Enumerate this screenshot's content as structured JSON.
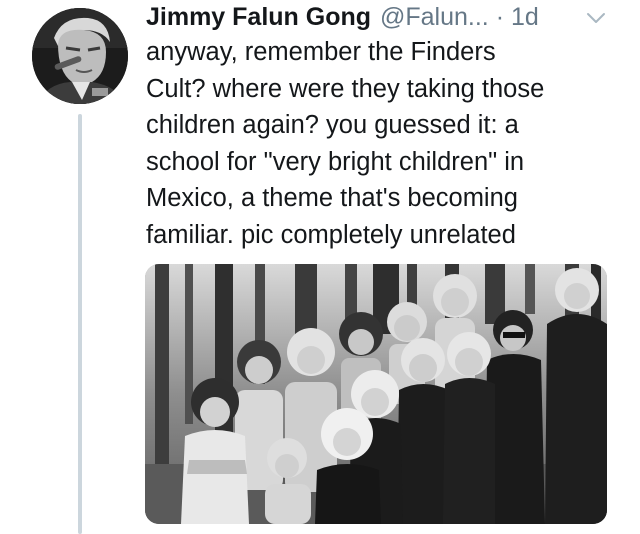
{
  "tweet": {
    "author": {
      "display_name": "Jimmy Falun Gong",
      "handle": "@Falun...",
      "separator": "·",
      "timestamp": "1d"
    },
    "menu_icon": "chevron-down-icon",
    "text_lines": [
      "anyway, remember the Finders",
      "Cult? where were they taking those",
      "children again? you guessed it: a",
      "school for \"very bright children\" in",
      "Mexico, a theme that's becoming",
      "familiar. pic completely unrelated"
    ],
    "media": {
      "type": "photo",
      "style": "black-and-white"
    }
  },
  "colors": {
    "text": "#14171a",
    "secondary": "#657786",
    "thread_line": "#ccd6dd",
    "background": "#ffffff"
  }
}
